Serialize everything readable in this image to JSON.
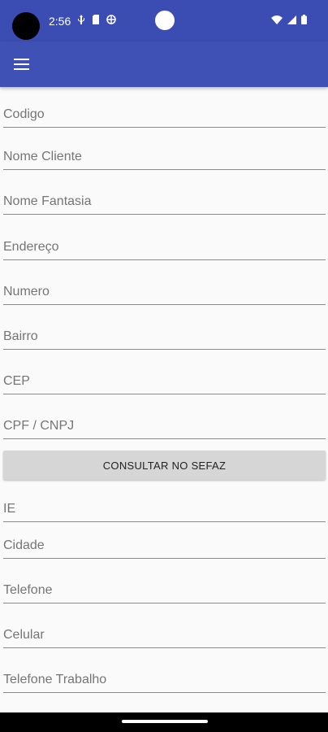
{
  "status_bar": {
    "time": "2:56"
  },
  "form": {
    "fields": [
      {
        "placeholder": "Codigo"
      },
      {
        "placeholder": "Nome Cliente"
      },
      {
        "placeholder": "Nome Fantasia"
      },
      {
        "placeholder": "Endereço"
      },
      {
        "placeholder": "Numero"
      },
      {
        "placeholder": "Bairro"
      },
      {
        "placeholder": "CEP"
      },
      {
        "placeholder": "CPF / CNPJ"
      }
    ],
    "consult_button": "CONSULTAR NO SEFAZ",
    "fields_after": [
      {
        "placeholder": "IE"
      },
      {
        "placeholder": "Cidade"
      },
      {
        "placeholder": "Telefone"
      },
      {
        "placeholder": "Celular"
      },
      {
        "placeholder": "Telefone Trabalho"
      }
    ]
  },
  "colors": {
    "primary": "#3f51b5",
    "status_bar": "#3b4db3",
    "background": "#fafafa",
    "button": "#d6d6d6"
  }
}
